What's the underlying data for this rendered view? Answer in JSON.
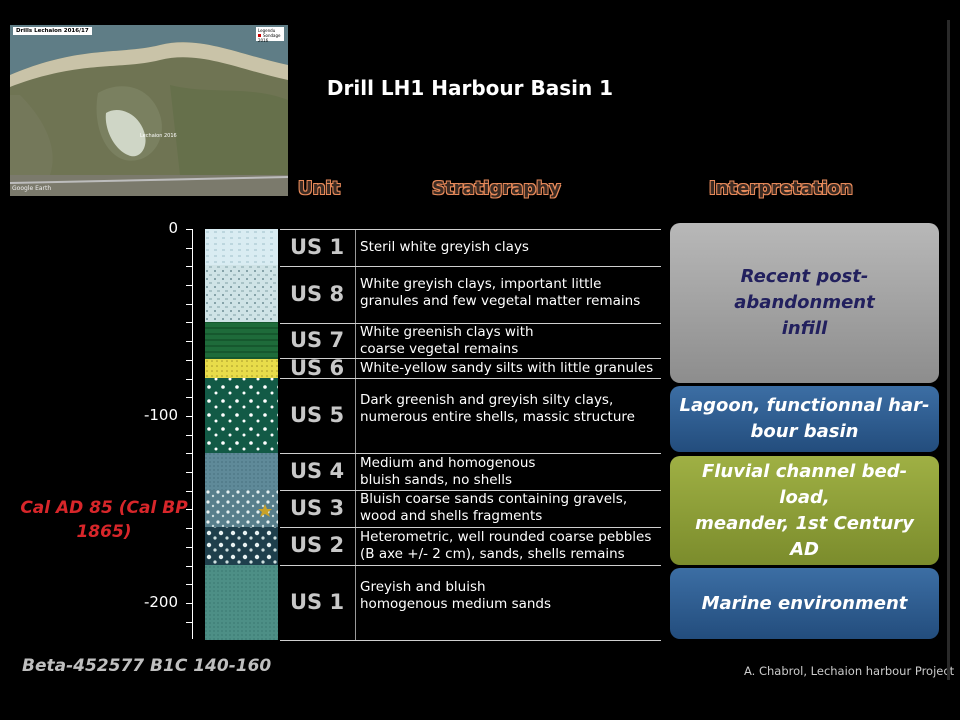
{
  "map": {
    "title": "Drills Lechaion 2016/17",
    "legend_title": "Legendu",
    "legend_item": "Sondage 2016",
    "watermark": "Google Earth",
    "label": "Lechaion 2016"
  },
  "title": "Drill LH1 Harbour Basin 1",
  "headers": {
    "unit": "Unit",
    "stratigraphy": "Stratigraphy",
    "interpretation": "Interpretation"
  },
  "depth_labels": [
    "0",
    "-100",
    "-200"
  ],
  "layers": [
    {
      "unit": "US 1",
      "desc": [
        "Steril white greyish clays"
      ]
    },
    {
      "unit": "US 8",
      "desc": [
        "White greyish clays, important little",
        "granules and few vegetal matter remains"
      ]
    },
    {
      "unit": "US 7",
      "desc": [
        "White greenish clays with",
        "coarse vegetal remains"
      ]
    },
    {
      "unit": "US 6",
      "desc": [
        "White-yellow sandy silts with little granules"
      ]
    },
    {
      "unit": "US 5",
      "desc": [
        "Dark greenish and greyish silty clays,",
        "numerous entire shells, massic structure"
      ]
    },
    {
      "unit": "US 4",
      "desc": [
        "Medium and homogenous",
        "bluish sands, no shells"
      ]
    },
    {
      "unit": "US 3",
      "desc": [
        "Bluish coarse sands containing gravels,",
        "wood  and shells fragments"
      ]
    },
    {
      "unit": "US 2",
      "desc": [
        "Heterometric, well rounded coarse pebbles",
        "(B axe +/- 2 cm), sands, shells remains"
      ]
    },
    {
      "unit": "US 1",
      "desc": [
        "Greyish and bluish",
        "homogenous medium sands"
      ]
    }
  ],
  "interpretations": [
    {
      "text": [
        "Recent post-abandonment",
        "infill"
      ]
    },
    {
      "text": [
        "Lagoon, functionnal har-",
        "bour basin"
      ]
    },
    {
      "text": [
        "Fluvial channel bed-load,",
        "meander, 1st Century AD"
      ]
    },
    {
      "text": [
        "Marine environment"
      ]
    }
  ],
  "dating": {
    "line1": "Cal AD 85 (Cal BP",
    "line2": "1865)"
  },
  "sample_ref": "Beta-452577 B1C 140-160",
  "credit": "A. Chabrol, Lechaion harbour Project",
  "colors": {
    "interp_infill": "#9a9a9a",
    "interp_lagoon": "#2f5f96",
    "interp_fluvial": "#98a83c",
    "interp_marine": "#2f5f96",
    "dating_red": "#d8262a",
    "header_outline": "#e88a5a"
  }
}
